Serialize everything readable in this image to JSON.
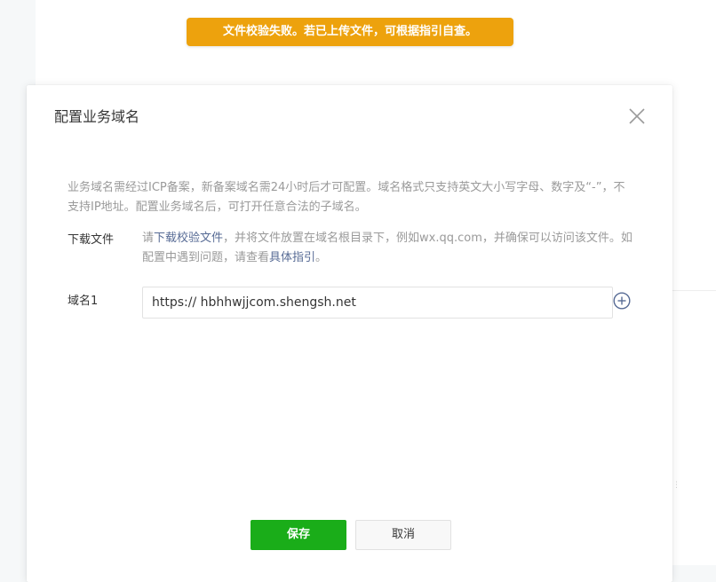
{
  "toast": {
    "message": "文件校验失败。若已上传文件，可根据指引自查。",
    "color": "#eda20d"
  },
  "dialog": {
    "title": "配置业务域名",
    "close_icon": "close-icon",
    "notice": "业务域名需经过ICP备案，新备案域名需24小时后才可配置。域名格式只支持英文大小写字母、数字及“-”，不支持IP地址。配置业务域名后，可打开任意合法的子域名。",
    "download": {
      "label": "下载文件",
      "text_prefix": "请",
      "link_text": "下载校验文件",
      "text_middle": "，并将文件放置在域名根目录下，例如wx.qq.com，并确保可以访问该文件。如配置中遇到问题，请查看",
      "guide_link_text": "具体指引",
      "text_suffix": "。"
    },
    "domain_row": {
      "label": "域名1",
      "value": "https:// hbhhwjjcom.shengsh.net",
      "add_icon": "plus-circle-icon"
    },
    "buttons": {
      "save_label": "保存",
      "cancel_label": "取消"
    }
  },
  "colors": {
    "primary_green": "#1aad19",
    "link_blue": "#576b95",
    "warning_orange": "#eda20d"
  }
}
